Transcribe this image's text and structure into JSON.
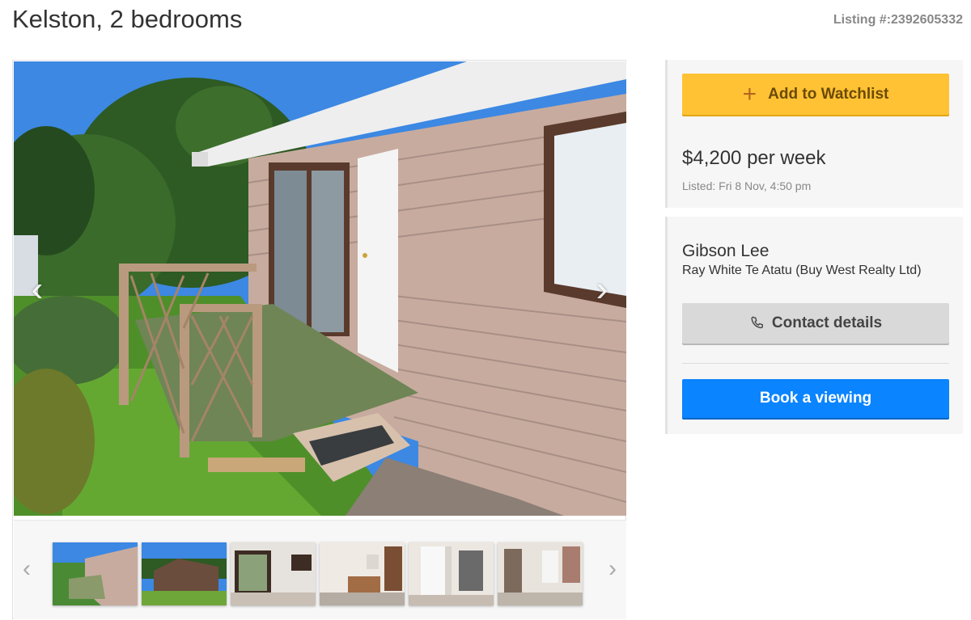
{
  "header": {
    "title": "Kelston, 2 bedrooms",
    "listing_number": "Listing #:2392605332"
  },
  "gallery": {
    "prev_icon": "chevron-left-icon",
    "next_icon": "chevron-right-icon",
    "thumbnail_count": 6
  },
  "watchlist": {
    "button_label": "Add to Watchlist",
    "icon": "plus-icon"
  },
  "pricing": {
    "price": "$4,200 per week",
    "listed": "Listed: Fri 8 Nov, 4:50 pm"
  },
  "agent": {
    "name": "Gibson Lee",
    "agency": "Ray White Te Atatu (Buy West Realty Ltd)",
    "contact_label": "Contact details",
    "contact_icon": "phone-icon",
    "book_label": "Book a viewing"
  },
  "colors": {
    "watchlist_button": "#ffc234",
    "book_button": "#0a84ff",
    "contact_button": "#d9d9d9"
  }
}
